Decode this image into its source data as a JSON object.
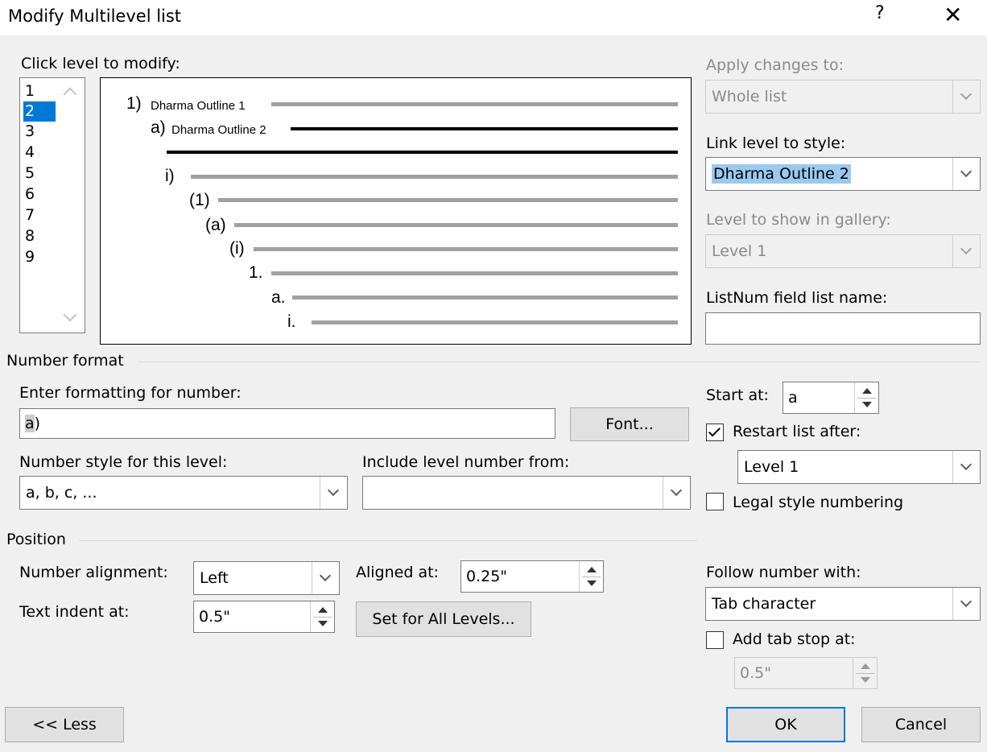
{
  "dialog": {
    "title": "Modify Multilevel list",
    "help_label": "?",
    "close_label": "✕"
  },
  "levels": {
    "label": "Click level to modify:",
    "items": [
      "1",
      "2",
      "3",
      "4",
      "5",
      "6",
      "7",
      "8",
      "9"
    ],
    "selected_index": 1
  },
  "preview": {
    "rows": [
      {
        "number": "1)",
        "text": "Dharma Outline 1"
      },
      {
        "number": "a)",
        "text": "Dharma Outline 2"
      },
      {
        "number": "i)",
        "text": ""
      },
      {
        "number": "(1)",
        "text": ""
      },
      {
        "number": "(a)",
        "text": ""
      },
      {
        "number": "(i)",
        "text": ""
      },
      {
        "number": "1.",
        "text": ""
      },
      {
        "number": "a.",
        "text": ""
      },
      {
        "number": "i.",
        "text": ""
      }
    ]
  },
  "right_panel": {
    "apply_label": "Apply changes to:",
    "apply_value": "Whole list",
    "link_label": "Link level to style:",
    "link_value": "Dharma Outline 2",
    "gallery_label": "Level to show in gallery:",
    "gallery_value": "Level 1",
    "listnum_label": "ListNum field list name:",
    "listnum_value": ""
  },
  "number_format": {
    "section_label": "Number format",
    "enter_label": "Enter formatting for number:",
    "enter_value_hl": "a",
    "enter_value_rest": ")",
    "font_button": "Font...",
    "style_label": "Number style for this level:",
    "style_value": "a, b, c, ...",
    "include_label": "Include level number from:",
    "include_value": "",
    "start_label": "Start at:",
    "start_value": "a",
    "restart_label": "Restart list after:",
    "restart_checked": true,
    "restart_value": "Level 1",
    "legal_label": "Legal style numbering",
    "legal_checked": false
  },
  "position": {
    "section_label": "Position",
    "alignment_label": "Number alignment:",
    "alignment_value": "Left",
    "aligned_at_label": "Aligned at:",
    "aligned_at_value": "0.25\"",
    "indent_label": "Text indent at:",
    "indent_value": "0.5\"",
    "set_all_button": "Set for All Levels...",
    "follow_label": "Follow number with:",
    "follow_value": "Tab character",
    "tabstop_label": "Add tab stop at:",
    "tabstop_checked": false,
    "tabstop_value": "0.5\""
  },
  "footer": {
    "less_button": "<< Less",
    "ok_button": "OK",
    "cancel_button": "Cancel"
  }
}
